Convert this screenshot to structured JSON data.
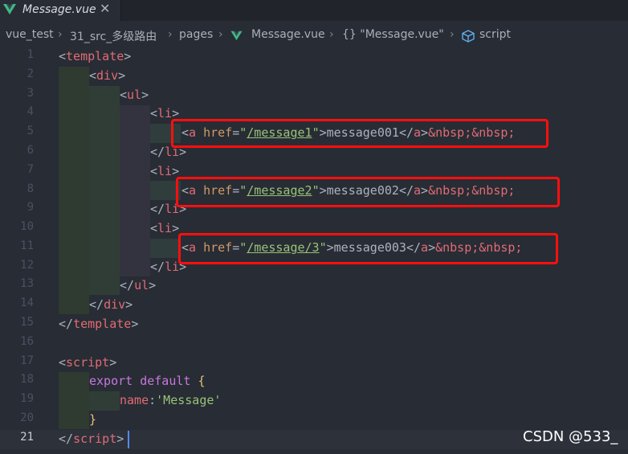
{
  "tab": {
    "filename": "Message.vue",
    "close_glyph": "✕",
    "icon": "vue-logo-icon"
  },
  "breadcrumb": {
    "items": [
      "vue_test",
      "31_src_多级路由",
      "pages",
      "Message.vue",
      "{} \"Message.vue\"",
      "script"
    ],
    "separator": "›"
  },
  "editor": {
    "line_numbers": [
      "1",
      "2",
      "3",
      "4",
      "5",
      "6",
      "7",
      "8",
      "9",
      "10",
      "11",
      "12",
      "13",
      "14",
      "15",
      "16",
      "17",
      "18",
      "19",
      "20",
      "21"
    ],
    "active_line": "21",
    "lines": {
      "l1": {
        "open": "<",
        "tag": "template",
        "close": ">"
      },
      "l2": {
        "open": "<",
        "tag": "div",
        "close": ">"
      },
      "l3": {
        "open": "<",
        "tag": "ul",
        "close": ">"
      },
      "l4": {
        "open": "<",
        "tag": "li",
        "close": ">"
      },
      "l5": {
        "lt": "<",
        "tag": "a",
        "attr": "href",
        "eq": "=",
        "q1": "\"",
        "href": "/message1",
        "q2": "\"",
        "gt": ">",
        "text": "message001",
        "endlt": "</",
        "endtag": "a",
        "endgt": ">",
        "entity": "&nbsp;&nbsp;"
      },
      "l6": {
        "open": "</",
        "tag": "li",
        "close": ">"
      },
      "l7": {
        "open": "<",
        "tag": "li",
        "close": ">"
      },
      "l8": {
        "lt": "<",
        "tag": "a",
        "attr": "href",
        "eq": "=",
        "q1": "\"",
        "href": "/message2",
        "q2": "\"",
        "gt": ">",
        "text": "message002",
        "endlt": "</",
        "endtag": "a",
        "endgt": ">",
        "entity": "&nbsp;&nbsp;"
      },
      "l9": {
        "open": "</",
        "tag": "li",
        "close": ">"
      },
      "l10": {
        "open": "<",
        "tag": "li",
        "close": ">"
      },
      "l11": {
        "lt": "<",
        "tag": "a",
        "attr": "href",
        "eq": "=",
        "q1": "\"",
        "href": "/message/3",
        "q2": "\"",
        "gt": ">",
        "text": "message003",
        "endlt": "</",
        "endtag": "a",
        "endgt": ">",
        "entity": "&nbsp;&nbsp;"
      },
      "l12": {
        "open": "</",
        "tag": "li",
        "close": ">"
      },
      "l13": {
        "open": "</",
        "tag": "ul",
        "close": ">"
      },
      "l14": {
        "open": "</",
        "tag": "div",
        "close": ">"
      },
      "l15": {
        "open": "</",
        "tag": "template",
        "close": ">"
      },
      "l17": {
        "open": "<",
        "tag": "script",
        "close": ">"
      },
      "l18": {
        "kw1": "export",
        "kw2": "default",
        "brace": "{"
      },
      "l19": {
        "prop": "name",
        "colon": ":",
        "value": "'Message'"
      },
      "l20": {
        "brace": "}"
      },
      "l21": {
        "open": "</",
        "tag": "script",
        "close": ">"
      }
    }
  },
  "watermark": "CSDN @533_",
  "colors": {
    "highlight_box": "#ff0f0f",
    "background": "#282c34"
  }
}
